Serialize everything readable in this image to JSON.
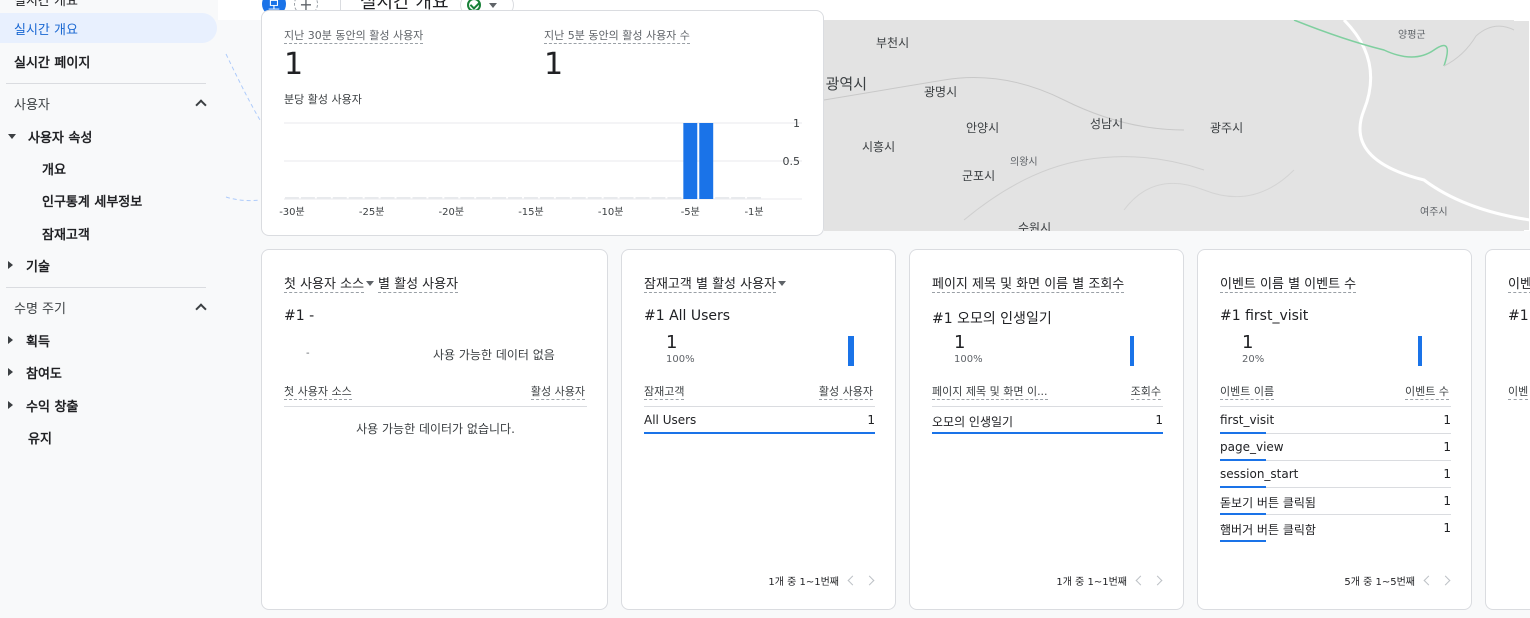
{
  "sidebar": {
    "cut_top": "실시간 개요",
    "items": [
      {
        "label": "실시간 개요",
        "active": true
      },
      {
        "label": "실시간 페이지"
      }
    ],
    "section_user": "사용자",
    "user_attr": "사용자 속성",
    "user_attr_children": [
      "개요",
      "인구통계 세부정보",
      "잠재고객"
    ],
    "tech": "기술",
    "section_lifecycle": "수명 주기",
    "lifecycle_items": [
      "획득",
      "참여도",
      "수익 창출",
      "유지"
    ]
  },
  "topbar": {
    "avatar_letter": "모",
    "plus": "+",
    "title": "실시간 개요"
  },
  "realtime": {
    "label_30min": "지난 30분 동안의 활성 사용자",
    "value_30min": "1",
    "label_5min": "지난 5분 동안의 활성 사용자 수",
    "value_5min": "1",
    "per_minute_label": "분당 활성 사용자",
    "y_ticks": [
      "1",
      "0.5"
    ],
    "x_ticks": [
      "-30분",
      "-25분",
      "-20분",
      "-15분",
      "-10분",
      "-5분",
      "-1분"
    ]
  },
  "chart_data": {
    "type": "bar",
    "title": "분당 활성 사용자",
    "x": [
      -30,
      -29,
      -28,
      -27,
      -26,
      -25,
      -24,
      -23,
      -22,
      -21,
      -20,
      -19,
      -18,
      -17,
      -16,
      -15,
      -14,
      -13,
      -12,
      -11,
      -10,
      -9,
      -8,
      -7,
      -6,
      -5,
      -4,
      -3,
      -2,
      -1
    ],
    "values": [
      0,
      0,
      0,
      0,
      0,
      0,
      0,
      0,
      0,
      0,
      0,
      0,
      0,
      0,
      0,
      0,
      0,
      0,
      0,
      0,
      0,
      0,
      0,
      0,
      0,
      1,
      1,
      0,
      0,
      0
    ],
    "ylim": [
      0,
      1
    ],
    "grid": true,
    "bar_color": "#1a73e8"
  },
  "map": {
    "labels": [
      "부천시",
      "인천광역시",
      "광명시",
      "안양시",
      "성남시",
      "광주시",
      "시흥시",
      "의왕시",
      "군포시",
      "수원시",
      "여주시",
      "양평군"
    ]
  },
  "cards": [
    {
      "title_a": "첫 사용자 소스",
      "title_b": "별 활성 사용자",
      "rank": "#1  -",
      "dash": "-",
      "no_data": "사용 가능한 데이터 없음",
      "col1": "첫 사용자 소스",
      "col2": "활성 사용자",
      "empty_table": "사용 가능한 데이터가 없습니다."
    },
    {
      "title_a": "잠재고객 별 활성 사용자",
      "rank": "#1  All Users",
      "value": "1",
      "pct": "100%",
      "col1": "잠재고객",
      "col2": "활성 사용자",
      "rows": [
        {
          "name": "All Users",
          "value": "1"
        }
      ],
      "pager": "1개 중 1~1번째"
    },
    {
      "title_a": "페이지 제목 및 화면 이름 별 조회수",
      "rank": "#1  오모의 인생일기",
      "value": "1",
      "pct": "100%",
      "col1": "페이지 제목 및 화면 이...",
      "col2": "조회수",
      "rows": [
        {
          "name": "오모의 인생일기",
          "value": "1"
        }
      ],
      "pager": "1개 중 1~1번째"
    },
    {
      "title_a": "이벤트 이름 별 이벤트 수",
      "rank": "#1  first_visit",
      "value": "1",
      "pct": "20%",
      "col1": "이벤트 이름",
      "col2": "이벤트 수",
      "rows": [
        {
          "name": "first_visit",
          "value": "1"
        },
        {
          "name": "page_view",
          "value": "1"
        },
        {
          "name": "session_start",
          "value": "1"
        },
        {
          "name": "돋보기 버튼 클릭됨",
          "value": "1"
        },
        {
          "name": "햄버거 버튼 클릭함",
          "value": "1"
        }
      ],
      "pager": "5개 중 1~5번째"
    },
    {
      "title_a": "이벤",
      "rank": "#1",
      "col1": "이벤"
    }
  ]
}
